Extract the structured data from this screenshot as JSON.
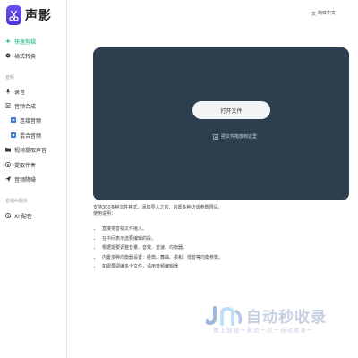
{
  "app": {
    "name": "声影"
  },
  "header": {
    "language_label": "简体中文"
  },
  "sidebar": {
    "items": [
      {
        "label": "快速剪辑",
        "icon": "sparkle-icon",
        "active": true
      },
      {
        "label": "格式转换",
        "icon": "convert-icon"
      }
    ],
    "section_audio": "音频",
    "audio_items": [
      {
        "label": "录音",
        "icon": "microphone-icon"
      },
      {
        "label": "音频合成",
        "icon": "file-icon"
      },
      {
        "label": "连接音频",
        "icon": "link-icon",
        "sub": true
      },
      {
        "label": "混合音频",
        "icon": "mix-icon",
        "sub": true
      },
      {
        "label": "视频提取声音",
        "icon": "folder-icon"
      },
      {
        "label": "提取伴奏",
        "icon": "accompany-icon"
      },
      {
        "label": "音频降噪",
        "icon": "send-icon"
      }
    ],
    "section_tools": "音视AI服务",
    "tool_items": [
      {
        "label": "AI 配音",
        "icon": "ai-icon"
      }
    ]
  },
  "upload": {
    "open_label": "打开文件",
    "drop_hint": "把文件拖放到这里"
  },
  "info": {
    "intro": "支持300多种文件格式，添加导入之前，内置多种访谈参数预设。",
    "usage_title": "使用说明：",
    "steps": [
      "直接将音视文件拖入。",
      "在中间表示选要编辑的段。",
      "根据需要调整音量、音效、音速、均衡器。",
      "内置多种均衡器设置：经典、舞曲、柔和、低音等均衡参数。",
      "如需要调编多个文件，请用音频编辑器"
    ]
  },
  "watermark": {
    "title": "自动秒收录",
    "slogan": "做上链接一来访一次一自动收录一"
  },
  "colors": {
    "accent": "#15b67a",
    "panel": "#2d3e4e",
    "logo": "#5a43e6",
    "watermark": "#c4d0e2"
  }
}
